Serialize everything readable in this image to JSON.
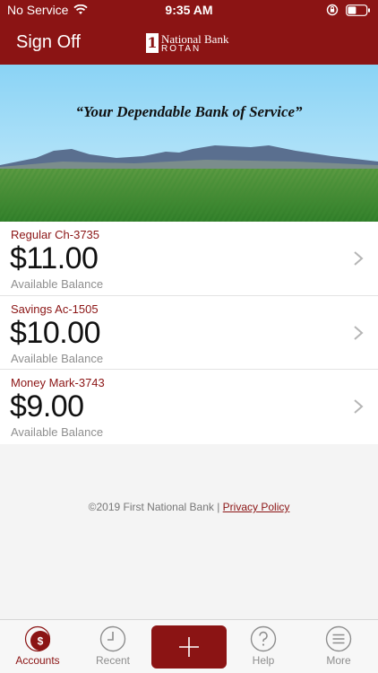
{
  "status_bar": {
    "carrier": "No Service",
    "time": "9:35 AM"
  },
  "nav": {
    "sign_off": "Sign Off",
    "logo_line1": "National Bank",
    "logo_line2": "ROTAN"
  },
  "banner": {
    "tagline": "“Your Dependable Bank of Service”"
  },
  "accounts": [
    {
      "name": "Regular Ch-3735",
      "balance": "$11.00",
      "label": "Available Balance"
    },
    {
      "name": "Savings Ac-1505",
      "balance": "$10.00",
      "label": "Available Balance"
    },
    {
      "name": "Money Mark-3743",
      "balance": "$9.00",
      "label": "Available Balance"
    }
  ],
  "footer": {
    "copyright": "©2019 First National Bank | ",
    "privacy": "Privacy Policy"
  },
  "tabs": [
    {
      "label": "Accounts",
      "icon": "dollar-circle-icon",
      "active": true
    },
    {
      "label": "Recent",
      "icon": "clock-icon",
      "active": false
    },
    {
      "label": "",
      "icon": "plus-icon",
      "active": false
    },
    {
      "label": "Help",
      "icon": "question-icon",
      "active": false
    },
    {
      "label": "More",
      "icon": "menu-icon",
      "active": false
    }
  ],
  "colors": {
    "brand": "#8b1414",
    "sky": "#87cdf0",
    "field": "#3d8a2c"
  }
}
